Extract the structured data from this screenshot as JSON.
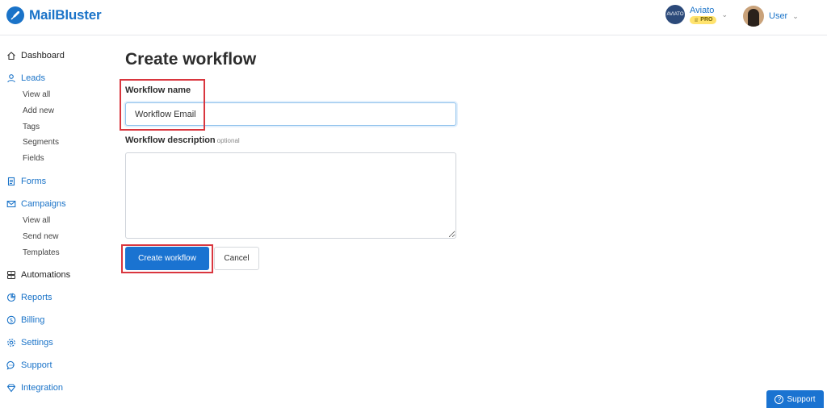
{
  "brand": {
    "name": "MailBluster",
    "logo_icon": "rocket-icon",
    "color": "#1a73c8"
  },
  "account": {
    "avatar_text": "AVIATO",
    "name": "Aviato",
    "badge": "PRO"
  },
  "user": {
    "name": "User"
  },
  "sidebar": {
    "dashboard": {
      "label": "Dashboard",
      "icon": "home-icon"
    },
    "leads": {
      "label": "Leads",
      "icon": "user-icon",
      "items": [
        "View all",
        "Add new",
        "Tags",
        "Segments",
        "Fields"
      ]
    },
    "forms": {
      "label": "Forms",
      "icon": "form-icon"
    },
    "campaigns": {
      "label": "Campaigns",
      "icon": "mail-icon",
      "items": [
        "View all",
        "Send new",
        "Templates"
      ]
    },
    "automations": {
      "label": "Automations",
      "icon": "automation-icon"
    },
    "reports": {
      "label": "Reports",
      "icon": "chart-icon"
    },
    "billing": {
      "label": "Billing",
      "icon": "dollar-icon"
    },
    "settings": {
      "label": "Settings",
      "icon": "gear-icon"
    },
    "support": {
      "label": "Support",
      "icon": "chat-icon"
    },
    "integration": {
      "label": "Integration",
      "icon": "diamond-icon"
    }
  },
  "main": {
    "title": "Create workflow",
    "name_label": "Workflow name",
    "name_value": "Workflow Email",
    "description_label": "Workflow description",
    "description_optional": "optional",
    "description_value": "",
    "create_button": "Create workflow",
    "cancel_button": "Cancel"
  },
  "support_fab": {
    "label": "Support",
    "icon": "help-circle-icon"
  },
  "colors": {
    "primary": "#1a73d1",
    "highlight": "#d9363e",
    "badge": "#ffe36e"
  }
}
